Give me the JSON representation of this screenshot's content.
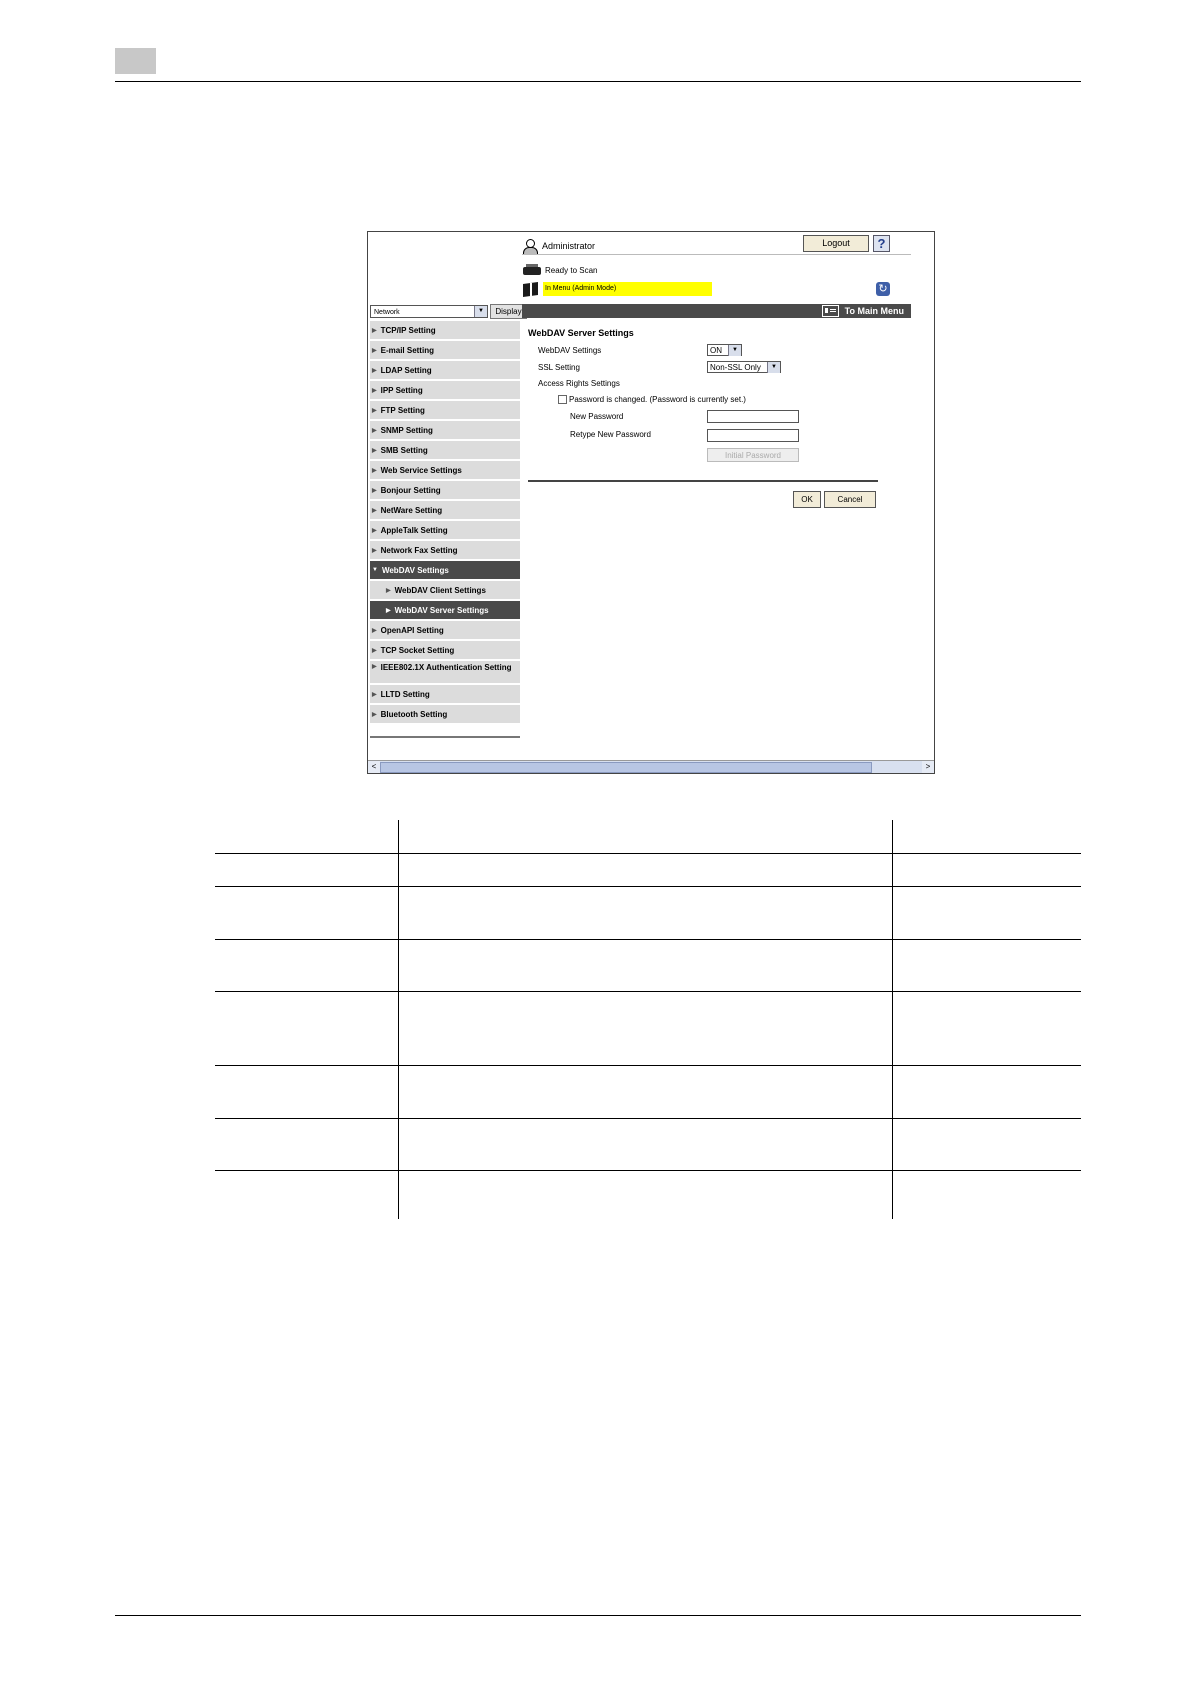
{
  "header": {
    "admin_label": "Administrator",
    "logout_label": "Logout",
    "help_label": "?",
    "status_ready": "Ready to Scan",
    "status_job": "In Menu (Admin Mode)"
  },
  "navbar": {
    "category_value": "Network",
    "display_label": "Display",
    "main_menu_label": "To Main Menu"
  },
  "side_menu": {
    "items": [
      {
        "label": "TCP/IP Setting"
      },
      {
        "label": "E-mail Setting"
      },
      {
        "label": "LDAP Setting"
      },
      {
        "label": "IPP Setting"
      },
      {
        "label": "FTP Setting"
      },
      {
        "label": "SNMP Setting"
      },
      {
        "label": "SMB Setting"
      },
      {
        "label": "Web Service Settings"
      },
      {
        "label": "Bonjour Setting"
      },
      {
        "label": "NetWare Setting"
      },
      {
        "label": "AppleTalk Setting"
      },
      {
        "label": "Network Fax Setting"
      },
      {
        "label": "WebDAV Settings"
      },
      {
        "label": "WebDAV Client Settings"
      },
      {
        "label": "WebDAV Server Settings"
      },
      {
        "label": "OpenAPI Setting"
      },
      {
        "label": "TCP Socket Setting"
      },
      {
        "label": "IEEE802.1X Authentication Setting"
      },
      {
        "label": "LLTD Setting"
      },
      {
        "label": "Bluetooth Setting"
      }
    ]
  },
  "content": {
    "title": "WebDAV Server Settings",
    "webdav_label": "WebDAV Settings",
    "webdav_value": "ON",
    "ssl_label": "SSL Setting",
    "ssl_value": "Non-SSL Only",
    "access_label": "Access Rights Settings",
    "password_changed_label": "Password is changed.  (Password is currently set.)",
    "new_password_label": "New Password",
    "retype_password_label": "Retype New Password",
    "initial_password_label": "Initial Password",
    "ok_label": "OK",
    "cancel_label": "Cancel"
  },
  "scrollbar": {
    "left": "<",
    "center": "|||",
    "right": ">"
  }
}
